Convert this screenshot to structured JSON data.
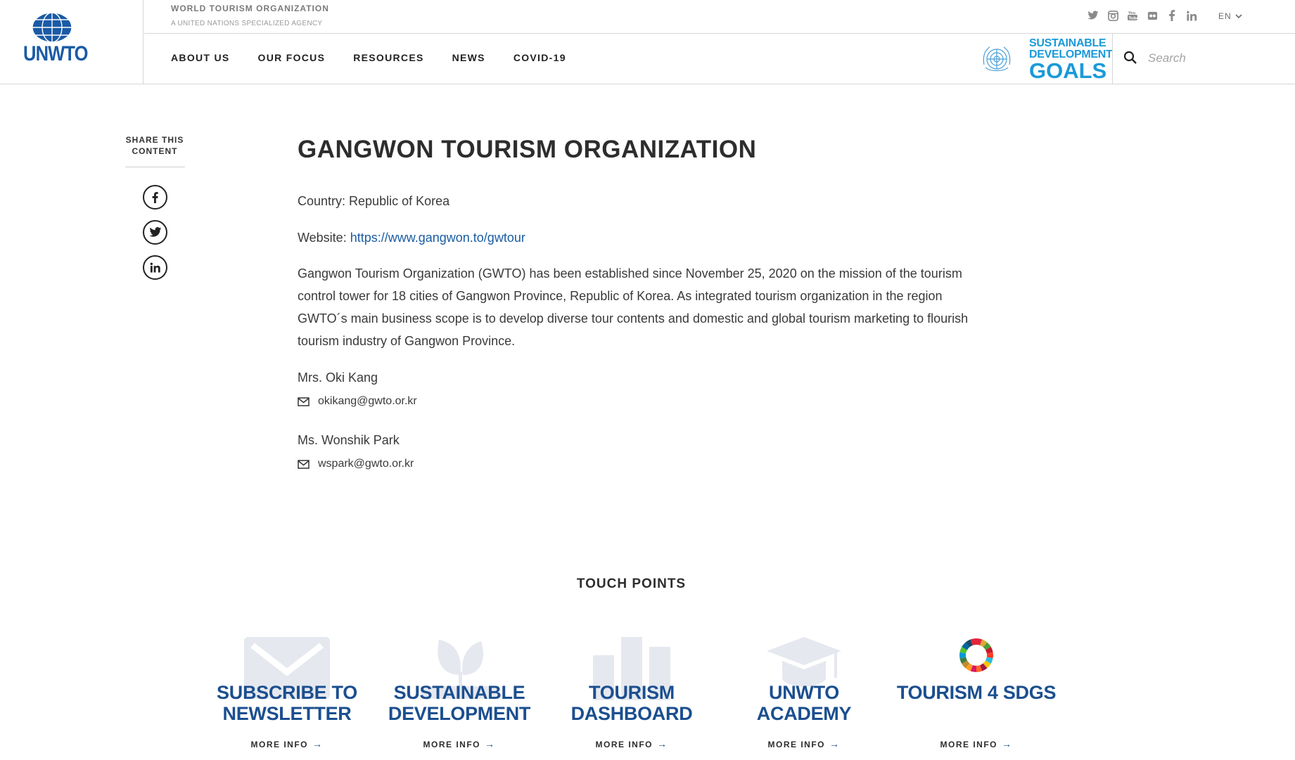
{
  "header": {
    "logo_text": "UNWTO",
    "org_name": "WORLD TOURISM ORGANIZATION",
    "org_subtitle": "A UNITED NATIONS SPECIALIZED AGENCY",
    "social_icons": [
      "twitter-icon",
      "instagram-icon",
      "youtube-icon",
      "flickr-icon",
      "facebook-icon",
      "linkedin-icon"
    ],
    "language": "EN",
    "nav": [
      "ABOUT US",
      "OUR FOCUS",
      "RESOURCES",
      "NEWS",
      "COVID-19"
    ],
    "sdg": {
      "line1": "SUSTAINABLE",
      "line2": "DEVELOPMENT",
      "line3": "GOALS"
    },
    "search_placeholder": "Search"
  },
  "share": {
    "title_line1": "SHARE THIS",
    "title_line2": "CONTENT",
    "buttons": [
      "facebook-icon",
      "twitter-icon",
      "linkedin-icon"
    ]
  },
  "main": {
    "title": "GANGWON TOURISM ORGANIZATION",
    "country_label": "Country: ",
    "country": "Republic of Korea",
    "website_label": "Website: ",
    "website": "https://www.gangwon.to/gwtour",
    "description": "Gangwon Tourism Organization (GWTO) has been established since November 25, 2020 on the mission of the tourism control tower for 18 cities of Gangwon Province, Republic of Korea. As integrated tourism organization in the region GWTO´s main business scope is to develop diverse tour contents and domestic and global tourism marketing to flourish tourism industry of Gangwon Province.",
    "contacts": [
      {
        "name": "Mrs. Oki Kang",
        "email": "okikang@gwto.or.kr"
      },
      {
        "name": "Ms. Wonshik Park",
        "email": "wspark@gwto.or.kr"
      }
    ]
  },
  "touch_points": {
    "heading": "TOUCH POINTS",
    "more_label": "MORE INFO",
    "items": [
      {
        "line1": "SUBSCRIBE TO",
        "line2": "NEWSLETTER",
        "icon": "envelope-icon"
      },
      {
        "line1": "SUSTAINABLE",
        "line2": "DEVELOPMENT",
        "icon": "plant-icon"
      },
      {
        "line1": "TOURISM",
        "line2": "DASHBOARD",
        "icon": "bar-chart-icon"
      },
      {
        "line1": "UNWTO",
        "line2": "ACADEMY",
        "icon": "graduation-cap-icon"
      },
      {
        "line1": "TOURISM 4 SDGS",
        "line2": "",
        "icon": "sdg-wheel-icon"
      }
    ]
  },
  "colors": {
    "brand_blue": "#1b5aa6",
    "link_blue": "#1a5ca3",
    "sdg_blue": "#1a9ad9",
    "touch_point_blue": "#1b4f8f"
  }
}
